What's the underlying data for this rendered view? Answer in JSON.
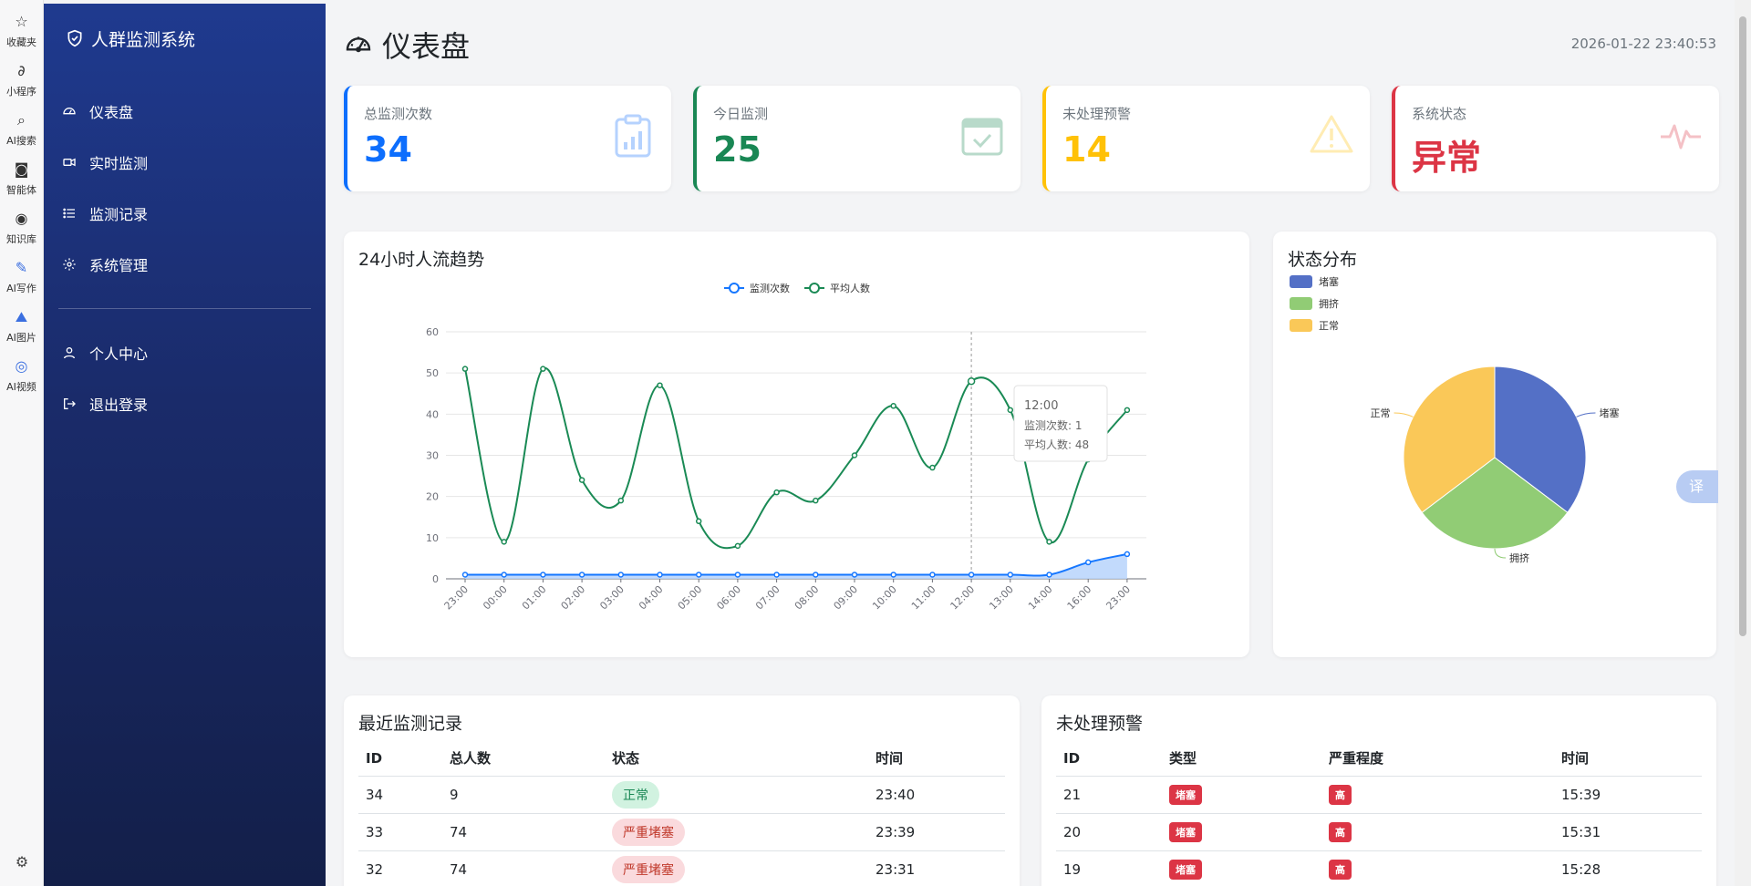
{
  "browser_rail": {
    "items": [
      {
        "label": "收藏夹",
        "icon": "star-icon"
      },
      {
        "label": "小程序",
        "icon": "link-icon"
      },
      {
        "label": "AI搜索",
        "icon": "search-icon"
      },
      {
        "label": "智能体",
        "icon": "bot-icon"
      },
      {
        "label": "知识库",
        "icon": "bulb-icon"
      },
      {
        "label": "AI写作",
        "icon": "pen-icon"
      },
      {
        "label": "AI图片",
        "icon": "image-icon"
      },
      {
        "label": "AI视频",
        "icon": "video-icon"
      }
    ]
  },
  "sidebar": {
    "brand": "人群监测系统",
    "nav": [
      {
        "label": "仪表盘",
        "icon": "gauge-icon"
      },
      {
        "label": "实时监测",
        "icon": "camera-icon"
      },
      {
        "label": "监测记录",
        "icon": "list-icon"
      },
      {
        "label": "系统管理",
        "icon": "gear-icon"
      }
    ],
    "nav_bottom": [
      {
        "label": "个人中心",
        "icon": "user-icon"
      },
      {
        "label": "退出登录",
        "icon": "logout-icon"
      }
    ]
  },
  "header": {
    "title": "仪表盘",
    "datetime": "2026-01-22 23:40:53"
  },
  "stats": [
    {
      "label": "总监测次数",
      "value": "34",
      "color": "#0d6efd",
      "icon": "clipboard-chart-icon"
    },
    {
      "label": "今日监测",
      "value": "25",
      "color": "#198754",
      "icon": "calendar-check-icon"
    },
    {
      "label": "未处理预警",
      "value": "14",
      "color": "#ffc107",
      "icon": "warning-icon"
    },
    {
      "label": "系统状态",
      "value": "异常",
      "color": "#dc3545",
      "icon": "pulse-icon"
    }
  ],
  "trend_panel": {
    "title": "24小时人流趋势",
    "tooltip": {
      "time": "12:00",
      "line1": "监测次数: 1",
      "line2": "平均人数: 48"
    }
  },
  "pie_panel": {
    "title": "状态分布"
  },
  "chart_data": [
    {
      "type": "line",
      "title": "24小时人流趋势",
      "x": [
        "23:00",
        "00:00",
        "01:00",
        "02:00",
        "03:00",
        "04:00",
        "05:00",
        "06:00",
        "07:00",
        "08:00",
        "09:00",
        "10:00",
        "11:00",
        "12:00",
        "13:00",
        "14:00",
        "16:00",
        "23:00"
      ],
      "series": [
        {
          "name": "监测次数",
          "values": [
            1,
            1,
            1,
            1,
            1,
            1,
            1,
            1,
            1,
            1,
            1,
            1,
            1,
            1,
            1,
            1,
            4,
            6
          ],
          "color": "#1677ff",
          "area": true
        },
        {
          "name": "平均人数",
          "values": [
            51,
            9,
            51,
            24,
            19,
            47,
            14,
            8,
            21,
            19,
            30,
            42,
            27,
            48,
            41,
            9,
            29,
            41
          ],
          "color": "#1a8a55"
        }
      ],
      "ylim": [
        0,
        60
      ],
      "yticks": [
        0,
        10,
        20,
        30,
        40,
        50,
        60
      ],
      "grid": true,
      "legend": "top-center"
    },
    {
      "type": "pie",
      "title": "状态分布",
      "slices": [
        {
          "name": "堵塞",
          "value": 12,
          "color": "#5470c6"
        },
        {
          "name": "拥挤",
          "value": 10,
          "color": "#91cc75"
        },
        {
          "name": "正常",
          "value": 12,
          "color": "#fac858"
        }
      ],
      "legend": "top-left"
    }
  ],
  "recent_records": {
    "title": "最近监测记录",
    "headers": [
      "ID",
      "总人数",
      "状态",
      "时间"
    ],
    "rows": [
      {
        "id": "34",
        "count": "9",
        "status": "正常",
        "status_type": "ok",
        "time": "23:40"
      },
      {
        "id": "33",
        "count": "74",
        "status": "严重堵塞",
        "status_type": "bad",
        "time": "23:39"
      },
      {
        "id": "32",
        "count": "74",
        "status": "严重堵塞",
        "status_type": "bad",
        "time": "23:31"
      }
    ]
  },
  "pending_alerts": {
    "title": "未处理预警",
    "headers": [
      "ID",
      "类型",
      "严重程度",
      "时间"
    ],
    "rows": [
      {
        "id": "21",
        "type": "堵塞",
        "severity": "高",
        "time": "15:39"
      },
      {
        "id": "20",
        "type": "堵塞",
        "severity": "高",
        "time": "15:31"
      },
      {
        "id": "19",
        "type": "堵塞",
        "severity": "高",
        "time": "15:28"
      }
    ]
  },
  "translate_label": "译"
}
